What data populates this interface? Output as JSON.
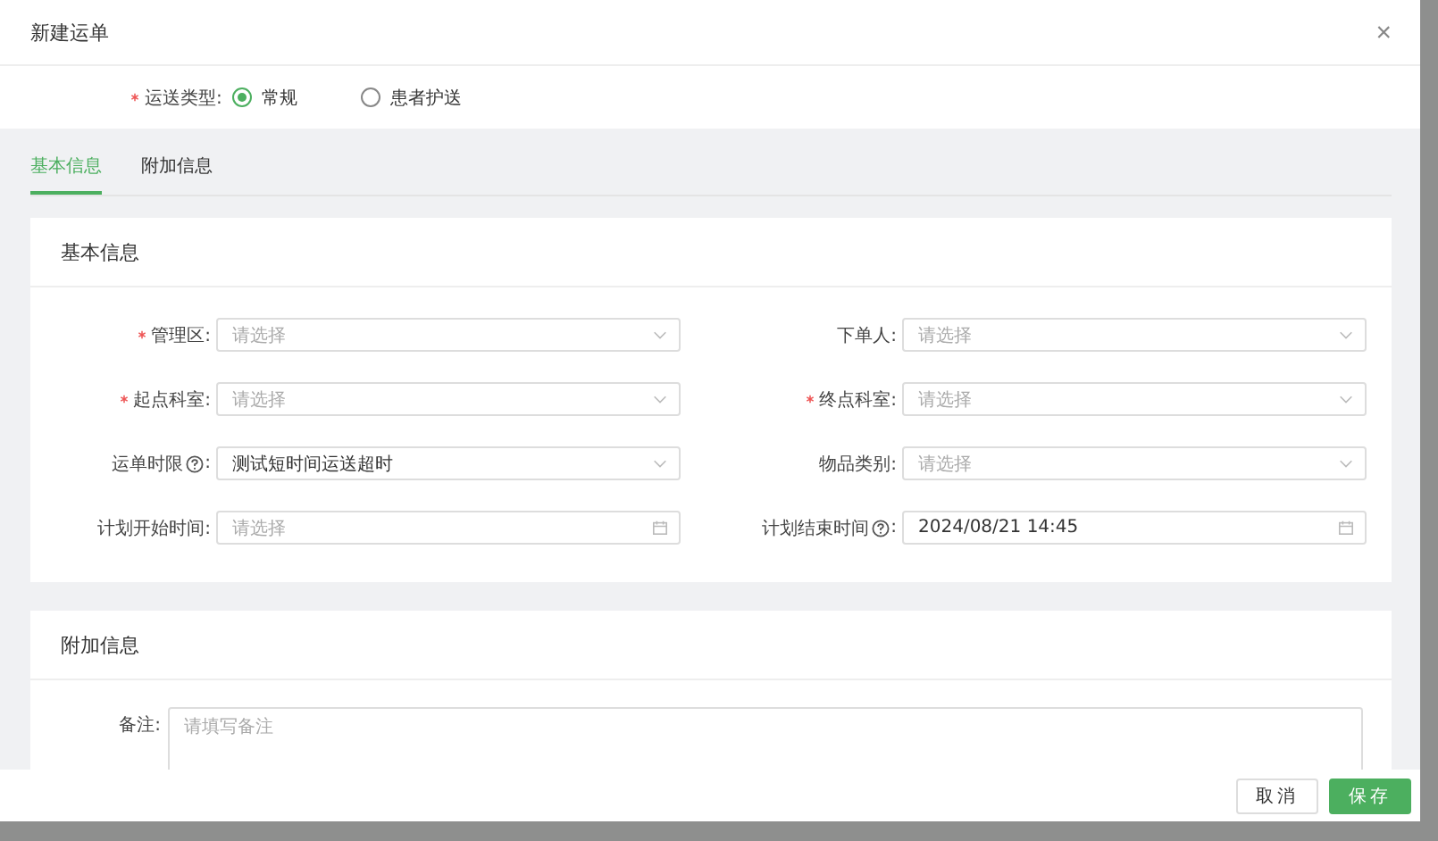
{
  "dialog": {
    "title": "新建运单",
    "close": "×"
  },
  "label_suffix": ":",
  "transport_type": {
    "label": "运送类型",
    "required": true,
    "options": [
      {
        "label": "常规",
        "selected": true
      },
      {
        "label": "患者护送",
        "selected": false
      }
    ]
  },
  "tabs": [
    {
      "label": "基本信息",
      "selected": true
    },
    {
      "label": "附加信息",
      "selected": false
    }
  ],
  "basic_section": {
    "title": "基本信息",
    "fields": [
      {
        "label": "管理区",
        "required": true,
        "help": false,
        "kind": "select",
        "placeholder": "请选择"
      },
      {
        "label": "下单人",
        "required": false,
        "help": false,
        "kind": "select",
        "placeholder": "请选择"
      },
      {
        "label": "起点科室",
        "required": true,
        "help": false,
        "kind": "select",
        "placeholder": "请选择"
      },
      {
        "label": "终点科室",
        "required": true,
        "help": false,
        "kind": "select",
        "placeholder": "请选择"
      },
      {
        "label": "运单时限",
        "required": false,
        "help": true,
        "kind": "select",
        "value": "测试短时间运送超时"
      },
      {
        "label": "物品类别",
        "required": false,
        "help": false,
        "kind": "select",
        "placeholder": "请选择"
      },
      {
        "label": "计划开始时间",
        "required": false,
        "help": false,
        "kind": "date",
        "placeholder": "请选择"
      },
      {
        "label": "计划结束时间",
        "required": false,
        "help": true,
        "kind": "date",
        "value": "2024/08/21 14:45"
      }
    ]
  },
  "extra_section": {
    "title": "附加信息",
    "remark": {
      "label": "备注",
      "placeholder": "请填写备注"
    }
  },
  "buttons": [
    {
      "label": "取消",
      "kind": "default"
    },
    {
      "label": "保存",
      "kind": "primary"
    }
  ]
}
